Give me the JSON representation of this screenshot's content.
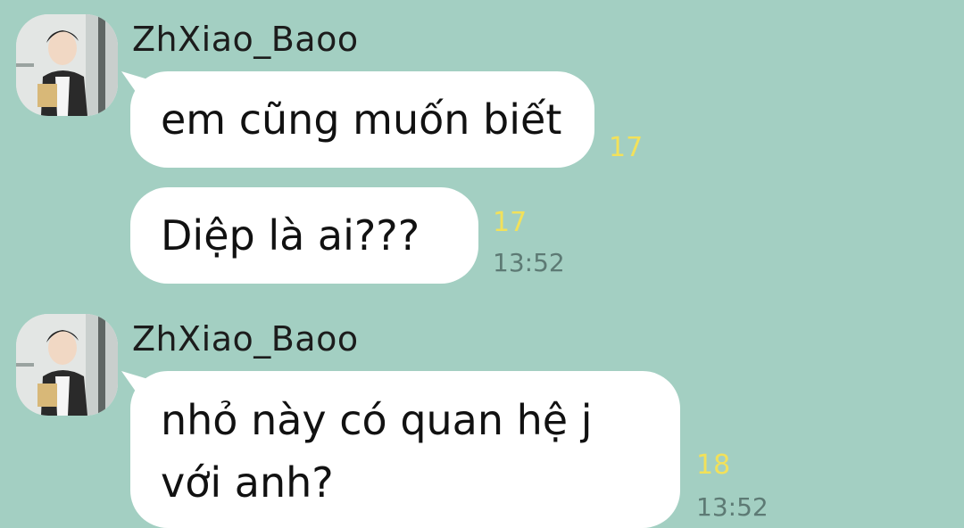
{
  "messages": [
    {
      "sender": "ZhXiao_Baoo",
      "avatar_icon": "user-avatar-photo",
      "bubbles": [
        {
          "text": "em cũng muốn biết",
          "read_count": "17",
          "time": ""
        },
        {
          "text": "Diệp là ai???",
          "read_count": "17",
          "time": "13:52"
        }
      ]
    },
    {
      "sender": "ZhXiao_Baoo",
      "avatar_icon": "user-avatar-photo",
      "bubbles": [
        {
          "text_line1": "nhỏ này có quan hệ j",
          "text_line2": "với anh?",
          "read_count": "18",
          "time": "13:52"
        }
      ]
    }
  ],
  "colors": {
    "background": "#a3cfc2",
    "bubble": "#ffffff",
    "read_count": "#f2e15a",
    "time": "#5d7a74"
  }
}
